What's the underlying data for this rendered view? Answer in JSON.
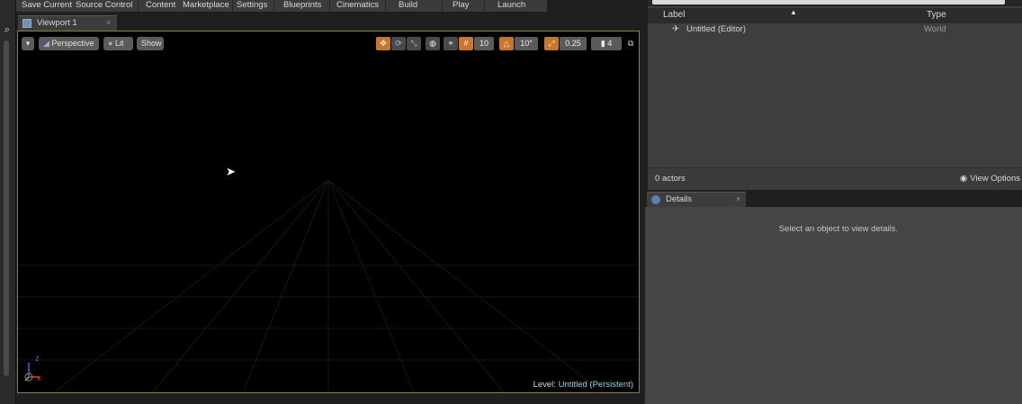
{
  "toolbar": {
    "items": [
      "Save Current",
      "Source Control",
      "Content",
      "Marketplace",
      "Settings",
      "Blueprints",
      "Cinematics",
      "Build",
      "Play",
      "Launch"
    ]
  },
  "viewport": {
    "tab_label": "Viewport 1",
    "view_mode": "Perspective",
    "lighting_mode": "Lit",
    "show_label": "Show",
    "grid_snap": "10",
    "rotation_snap": "10°",
    "scale_snap": "0.25",
    "camera_speed": "4",
    "level_prefix": "Level:",
    "level_name": "Untitled (Persistent)",
    "axis_x": "x",
    "axis_z": "z"
  },
  "outliner": {
    "columns": {
      "label": "Label",
      "type": "Type"
    },
    "rows": [
      {
        "label": "Untitled (Editor)",
        "type": "World"
      }
    ],
    "actors_count": "0 actors",
    "view_options": "View Options"
  },
  "details": {
    "tab_label": "Details",
    "empty_hint": "Select an object to view details."
  },
  "colors": {
    "accent_orange": "#c9762a",
    "viewport_border": "#8c7a52",
    "level_name": "#8fd1e6"
  },
  "icons": [
    "search-icon",
    "viewport-icon",
    "dropdown-icon",
    "perspective-icon",
    "lit-icon",
    "translate-icon",
    "rotate-icon",
    "scale-icon",
    "world-icon",
    "eye-icon",
    "details-icon",
    "close-icon",
    "maximize-icon",
    "axis-gizmo-icon",
    "mouse-cursor-icon"
  ]
}
